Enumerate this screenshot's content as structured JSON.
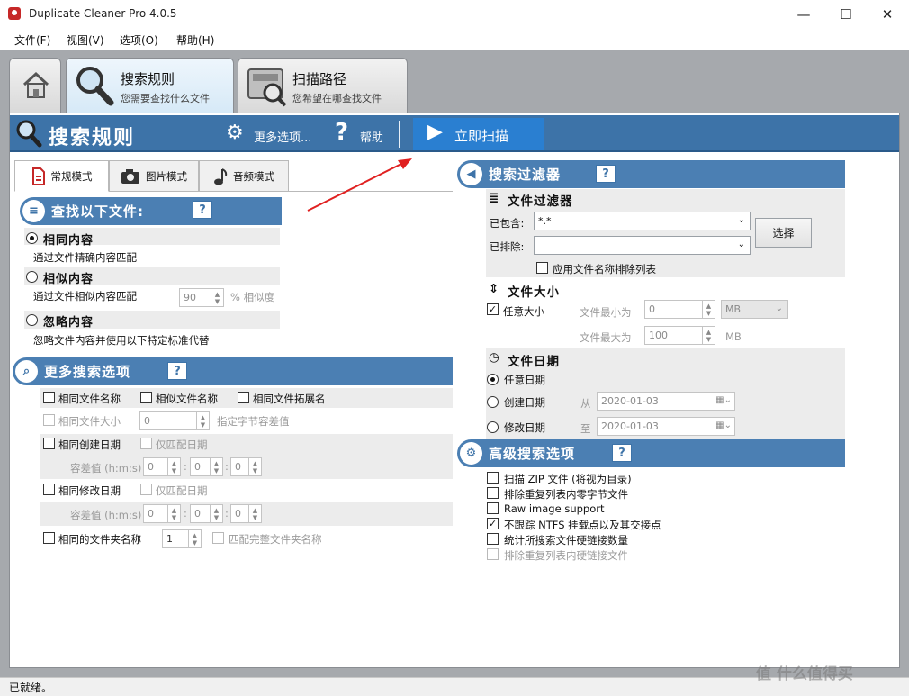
{
  "window": {
    "title": "Duplicate Cleaner Pro 4.0.5",
    "minimize": "—",
    "maximize": "☐",
    "close": "✕"
  },
  "menu": [
    "文件(F)",
    "视图(V)",
    "选项(O)",
    "帮助(H)"
  ],
  "top_tabs": {
    "home": {
      "icon": "home-icon"
    },
    "search_rules": {
      "title": "搜索规则",
      "subtitle": "您需要查找什么文件"
    },
    "scan_paths": {
      "title": "扫描路径",
      "subtitle": "您希望在哪查找文件"
    }
  },
  "header": {
    "title": "搜索规则",
    "more_options": "更多选项...",
    "help": "帮助",
    "scan_now": "立即扫描",
    "more_options_glyph": "⚙",
    "help_glyph": "?",
    "scan_glyph": "▶"
  },
  "mode_tabs": [
    {
      "label": "常规模式",
      "icon": "document-icon"
    },
    {
      "label": "图片模式",
      "icon": "camera-icon"
    },
    {
      "label": "音频模式",
      "icon": "music-note-icon"
    }
  ],
  "find_files": {
    "title": "查找以下文件:",
    "help": "?",
    "options": [
      {
        "label": "相同内容",
        "desc": "通过文件精确内容匹配",
        "selected": true
      },
      {
        "label": "相似内容",
        "desc": "通过文件相似内容匹配",
        "selected": false,
        "similarity_value": "90",
        "similarity_label": "% 相似度"
      },
      {
        "label": "忽略内容",
        "desc": "忽略文件内容并使用以下特定标准代替",
        "selected": false
      }
    ]
  },
  "more_search": {
    "title": "更多搜索选项",
    "help": "?",
    "same_name": "相同文件名称",
    "similar_name": "相似文件名称",
    "same_ext": "相同文件拓展名",
    "same_size": "相同文件大小",
    "size_value": "0",
    "size_tolerance": "指定字节容差值",
    "same_created": "相同创建日期",
    "created_date_only": "仅匹配日期",
    "tolerance_label": "容差值 (h:m:s)",
    "tolerance_values": [
      "0",
      "0",
      "0"
    ],
    "same_modified": "相同修改日期",
    "modified_date_only": "仅匹配日期",
    "same_folder": "相同的文件夹名称",
    "folder_value": "1",
    "full_folder": "匹配完整文件夹名称"
  },
  "search_filter": {
    "title": "搜索过滤器",
    "help": "?",
    "file_filter": "文件过滤器",
    "include_label": "已包含:",
    "include_value": "*.*",
    "exclude_label": "已排除:",
    "exclude_value": "",
    "select_button": "选择",
    "apply_exclude": "应用文件名称排除列表",
    "file_size": "文件大小",
    "any_size": "任意大小",
    "min_label": "文件最小为",
    "min_value": "0",
    "unit_value": "MB",
    "max_label": "文件最大为",
    "max_value": "100",
    "max_unit": "MB",
    "file_date": "文件日期",
    "any_date": "任意日期",
    "created_date": "创建日期",
    "from_label": "从",
    "from_value": "2020-01-03",
    "modified_date": "修改日期",
    "to_label": "至",
    "to_value": "2020-01-03"
  },
  "advanced": {
    "title": "高级搜索选项",
    "help": "?",
    "items": [
      {
        "label": "扫描 ZIP 文件 (将视为目录)",
        "checked": false,
        "disabled": false
      },
      {
        "label": "排除重复列表内零字节文件",
        "checked": false,
        "disabled": false
      },
      {
        "label": "Raw image support",
        "checked": false,
        "disabled": false
      },
      {
        "label": "不跟踪 NTFS 挂载点以及其交接点",
        "checked": true,
        "disabled": false
      },
      {
        "label": "统计所搜索文件硬链接数量",
        "checked": false,
        "disabled": false
      },
      {
        "label": "排除重复列表内硬链接文件",
        "checked": false,
        "disabled": true
      }
    ]
  },
  "status": "已就绪。",
  "watermark": "值 什么值得买",
  "colors": {
    "header": "#3d73a8",
    "scan_button": "#2a7fd1",
    "section_header": "#4b7fb3",
    "frame": "#a6a9ad",
    "arrow": "#e02020"
  }
}
